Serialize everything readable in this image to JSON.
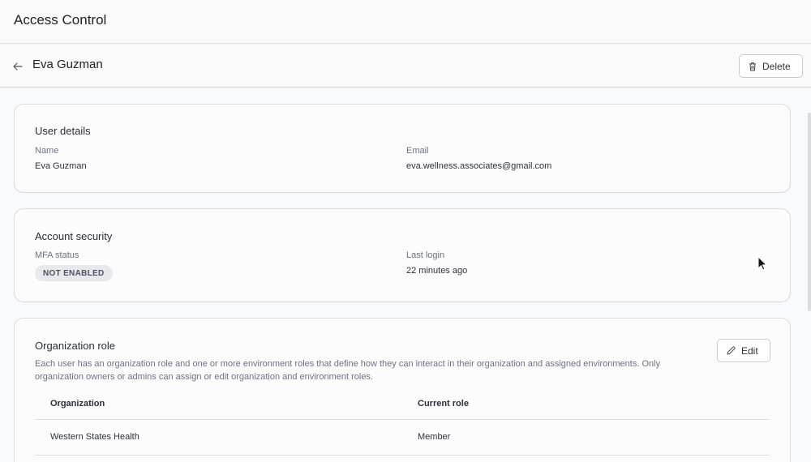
{
  "app": {
    "title": "Access Control"
  },
  "header": {
    "user_name": "Eva Guzman",
    "delete_label": "Delete"
  },
  "user_details": {
    "title": "User details",
    "name_label": "Name",
    "name_value": "Eva Guzman",
    "email_label": "Email",
    "email_value": "eva.wellness.associates@gmail.com"
  },
  "account_security": {
    "title": "Account security",
    "mfa_label": "MFA status",
    "mfa_value": "NOT ENABLED",
    "last_login_label": "Last login",
    "last_login_value": "22 minutes ago"
  },
  "org_role": {
    "title": "Organization role",
    "description": "Each user has an organization role and one or more environment roles that define how they can interact in their organization and assigned environments. Only organization owners or admins can assign or edit organization and environment roles.",
    "edit_label": "Edit",
    "columns": [
      "Organization",
      "Current role"
    ],
    "rows": [
      {
        "organization": "Western States Health",
        "role": "Member"
      }
    ]
  },
  "icons": {
    "back": "arrow-left-icon",
    "delete": "trash-icon",
    "edit": "pencil-icon"
  }
}
